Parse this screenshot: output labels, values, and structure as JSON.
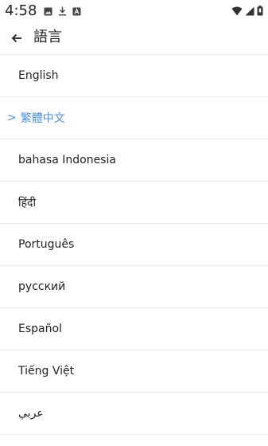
{
  "status_bar": {
    "time": "4:58",
    "left_icons": [
      "image-icon",
      "download-icon",
      "a-icon"
    ],
    "right_icons": [
      "wifi-icon",
      "signal-icon",
      "battery-icon"
    ]
  },
  "app_bar": {
    "back_icon": "arrow-left-icon",
    "title": "語言"
  },
  "selected_marker": ">",
  "languages": [
    {
      "label": "English",
      "selected": false
    },
    {
      "label": "繁體中文",
      "selected": true
    },
    {
      "label": "bahasa Indonesia",
      "selected": false
    },
    {
      "label": "हिंदी",
      "selected": false
    },
    {
      "label": "Português",
      "selected": false
    },
    {
      "label": "русский",
      "selected": false
    },
    {
      "label": "Español",
      "selected": false
    },
    {
      "label": "Tiếng Việt",
      "selected": false
    },
    {
      "label": "عربي",
      "selected": false
    }
  ],
  "colors": {
    "selected_text": "#4a90e2",
    "divider": "#ececec"
  }
}
